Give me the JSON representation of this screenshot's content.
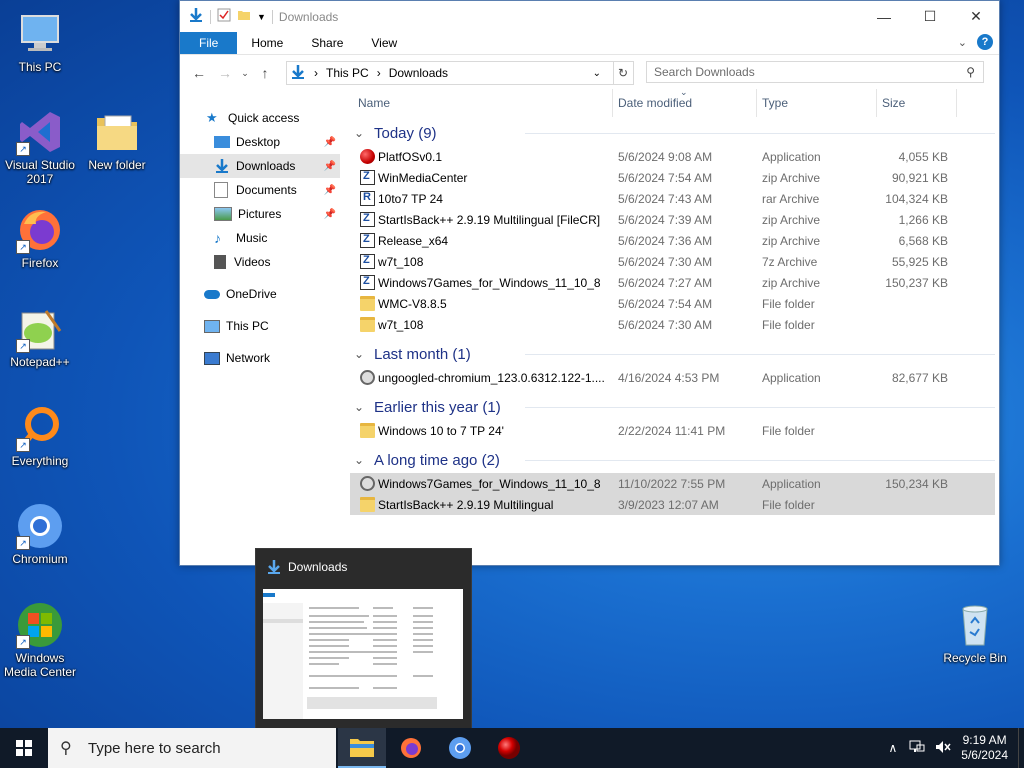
{
  "desktop": {
    "icons": [
      {
        "label": "This PC"
      },
      {
        "label": "Visual Studio 2017"
      },
      {
        "label": "New folder"
      },
      {
        "label": "Firefox"
      },
      {
        "label": "Notepad++"
      },
      {
        "label": "Everything"
      },
      {
        "label": "Chromium"
      },
      {
        "label": "Windows Media Center"
      },
      {
        "label": "Recycle Bin"
      }
    ]
  },
  "explorer": {
    "title": "Downloads",
    "ribbon_tabs": [
      "File",
      "Home",
      "Share",
      "View"
    ],
    "address": {
      "root": "This PC",
      "current": "Downloads"
    },
    "search_placeholder": "Search Downloads",
    "nav": {
      "quick_access": "Quick access",
      "items": [
        "Desktop",
        "Downloads",
        "Documents",
        "Pictures",
        "Music",
        "Videos"
      ],
      "onedrive": "OneDrive",
      "this_pc": "This PC",
      "network": "Network"
    },
    "columns": [
      "Name",
      "Date modified",
      "Type",
      "Size"
    ],
    "groups": [
      {
        "title": "Today (9)",
        "files": [
          {
            "name": "PlatfOSv0.1",
            "date": "5/6/2024 9:08 AM",
            "type": "Application",
            "size": "4,055 KB",
            "icon": "app-icon"
          },
          {
            "name": "WinMediaCenter",
            "date": "5/6/2024 7:54 AM",
            "type": "zip Archive",
            "size": "90,921 KB",
            "icon": "zip-icon"
          },
          {
            "name": "10to7 TP 24",
            "date": "5/6/2024 7:43 AM",
            "type": "rar Archive",
            "size": "104,324 KB",
            "icon": "rar-icon"
          },
          {
            "name": "StartIsBack++ 2.9.19 Multilingual [FileCR]",
            "date": "5/6/2024 7:39 AM",
            "type": "zip Archive",
            "size": "1,266 KB",
            "icon": "zip-icon"
          },
          {
            "name": "Release_x64",
            "date": "5/6/2024 7:36 AM",
            "type": "zip Archive",
            "size": "6,568 KB",
            "icon": "zip-icon"
          },
          {
            "name": "w7t_108",
            "date": "5/6/2024 7:30 AM",
            "type": "7z Archive",
            "size": "55,925 KB",
            "icon": "zip-icon"
          },
          {
            "name": "Windows7Games_for_Windows_11_10_8",
            "date": "5/6/2024 7:27 AM",
            "type": "zip Archive",
            "size": "150,237 KB",
            "icon": "zip-icon"
          },
          {
            "name": "WMC-V8.8.5",
            "date": "5/6/2024 7:54 AM",
            "type": "File folder",
            "size": "",
            "icon": "folder-icon"
          },
          {
            "name": "w7t_108",
            "date": "5/6/2024 7:30 AM",
            "type": "File folder",
            "size": "",
            "icon": "folder-icon"
          }
        ]
      },
      {
        "title": "Last month (1)",
        "files": [
          {
            "name": "ungoogled-chromium_123.0.6312.122-1....",
            "date": "4/16/2024 4:53 PM",
            "type": "Application",
            "size": "82,677 KB",
            "icon": "installer-icon"
          }
        ]
      },
      {
        "title": "Earlier this year (1)",
        "files": [
          {
            "name": "Windows 10 to 7 TP 24'",
            "date": "2/22/2024 11:41 PM",
            "type": "File folder",
            "size": "",
            "icon": "folder-icon"
          }
        ]
      },
      {
        "title": "A long time ago (2)",
        "files": [
          {
            "name": "Windows7Games_for_Windows_11_10_8",
            "date": "11/10/2022 7:55 PM",
            "type": "Application",
            "size": "150,234 KB",
            "icon": "installer-icon",
            "selected": true
          },
          {
            "name": "StartIsBack++ 2.9.19 Multilingual",
            "date": "3/9/2023 12:07 AM",
            "type": "File folder",
            "size": "",
            "icon": "folder-icon",
            "selected": true
          }
        ]
      }
    ]
  },
  "thumbnail": {
    "title": "Downloads"
  },
  "taskbar": {
    "search_placeholder": "Type here to search",
    "time": "9:19 AM",
    "date": "5/6/2024"
  }
}
